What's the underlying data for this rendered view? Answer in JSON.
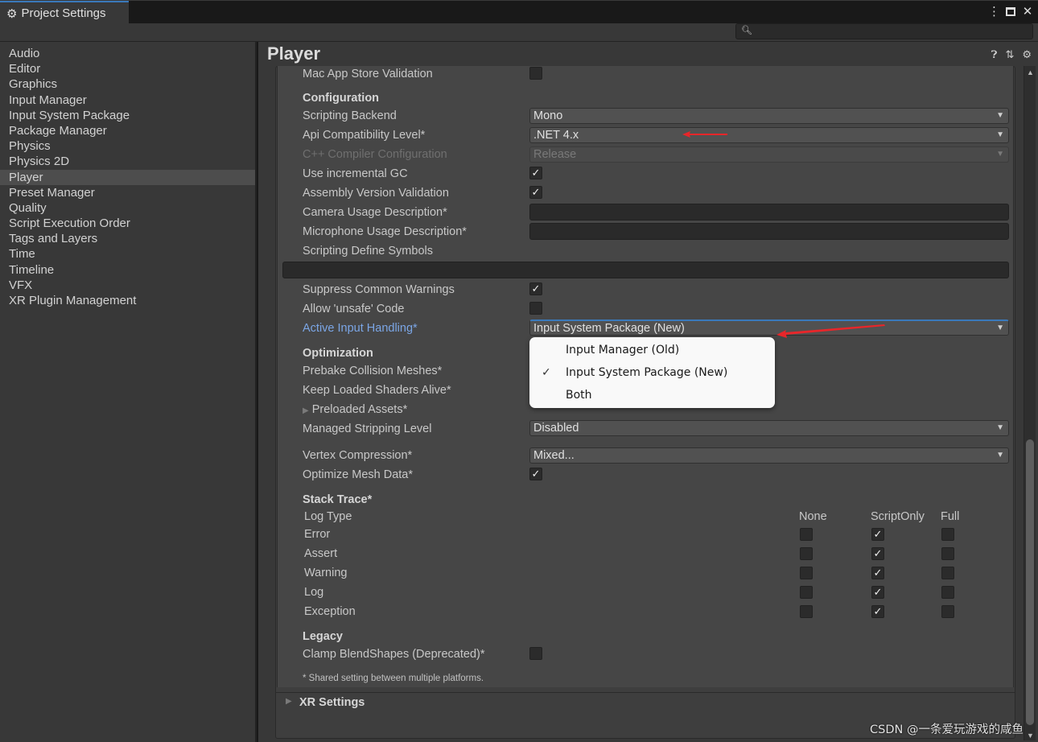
{
  "window": {
    "tab_title": "Project Settings",
    "controls": [
      "more-options",
      "maximize",
      "close"
    ]
  },
  "search": {
    "placeholder": "",
    "value": ""
  },
  "sidebar": {
    "items": [
      {
        "label": "Audio"
      },
      {
        "label": "Editor"
      },
      {
        "label": "Graphics"
      },
      {
        "label": "Input Manager"
      },
      {
        "label": "Input System Package"
      },
      {
        "label": "Package Manager"
      },
      {
        "label": "Physics"
      },
      {
        "label": "Physics 2D"
      },
      {
        "label": "Player",
        "active": true
      },
      {
        "label": "Preset Manager"
      },
      {
        "label": "Quality"
      },
      {
        "label": "Script Execution Order"
      },
      {
        "label": "Tags and Layers"
      },
      {
        "label": "Time"
      },
      {
        "label": "Timeline"
      },
      {
        "label": "VFX"
      },
      {
        "label": "XR Plugin Management"
      }
    ]
  },
  "main": {
    "title": "Player",
    "header_icons": [
      "help-icon",
      "presets-icon",
      "settings-gear-icon"
    ],
    "mac_app_store_validation": {
      "label": "Mac App Store Validation",
      "checked": false
    },
    "configuration": {
      "header": "Configuration",
      "scripting_backend": {
        "label": "Scripting Backend",
        "value": "Mono"
      },
      "api_compat": {
        "label": "Api Compatibility Level*",
        "value": ".NET 4.x"
      },
      "cpp_compiler": {
        "label": "C++ Compiler Configuration",
        "value": "Release",
        "disabled": true
      },
      "incremental_gc": {
        "label": "Use incremental GC",
        "checked": true
      },
      "assembly_validation": {
        "label": "Assembly Version Validation",
        "checked": true
      },
      "camera_usage": {
        "label": "Camera Usage Description*",
        "value": ""
      },
      "microphone_usage": {
        "label": "Microphone Usage Description*",
        "value": ""
      },
      "define_symbols": {
        "label": "Scripting Define Symbols",
        "value": ""
      },
      "suppress_warnings": {
        "label": "Suppress Common Warnings",
        "checked": true
      },
      "allow_unsafe": {
        "label": "Allow 'unsafe' Code",
        "checked": false
      },
      "active_input": {
        "label": "Active Input Handling*",
        "value": "Input System Package (New)"
      }
    },
    "input_popup": {
      "options": [
        {
          "label": "Input Manager (Old)",
          "selected": false
        },
        {
          "label": "Input System Package (New)",
          "selected": true
        },
        {
          "label": "Both",
          "selected": false
        }
      ],
      "check_glyph": "✓"
    },
    "optimization": {
      "header": "Optimization",
      "prebake": {
        "label": "Prebake Collision Meshes*"
      },
      "keep_shaders": {
        "label": "Keep Loaded Shaders Alive*"
      },
      "preloaded_assets": {
        "label": "Preloaded Assets*"
      },
      "stripping": {
        "label": "Managed Stripping Level",
        "value": "Disabled"
      },
      "vertex_compression": {
        "label": "Vertex Compression*",
        "value": "Mixed..."
      },
      "optimize_mesh": {
        "label": "Optimize Mesh Data*",
        "checked": true
      }
    },
    "stack_trace": {
      "header": "Stack Trace*",
      "log_type_label": "Log Type",
      "columns": [
        "None",
        "ScriptOnly",
        "Full"
      ],
      "rows": [
        {
          "label": "Error",
          "selected": "ScriptOnly"
        },
        {
          "label": "Assert",
          "selected": "ScriptOnly"
        },
        {
          "label": "Warning",
          "selected": "ScriptOnly"
        },
        {
          "label": "Log",
          "selected": "ScriptOnly"
        },
        {
          "label": "Exception",
          "selected": "ScriptOnly"
        }
      ]
    },
    "legacy": {
      "header": "Legacy",
      "clamp_blendshapes": {
        "label": "Clamp BlendShapes (Deprecated)*",
        "checked": false
      }
    },
    "footnote": "* Shared setting between multiple platforms.",
    "xr_settings": {
      "label": "XR Settings"
    }
  },
  "glyphs": {
    "check": "✓",
    "dropdown_arrow": "▼",
    "collapsed_triangle": "▶"
  },
  "annotation_color": "#e8262a",
  "accent_color": "#3a79bb",
  "watermark": "CSDN @一条爱玩游戏的咸鱼"
}
